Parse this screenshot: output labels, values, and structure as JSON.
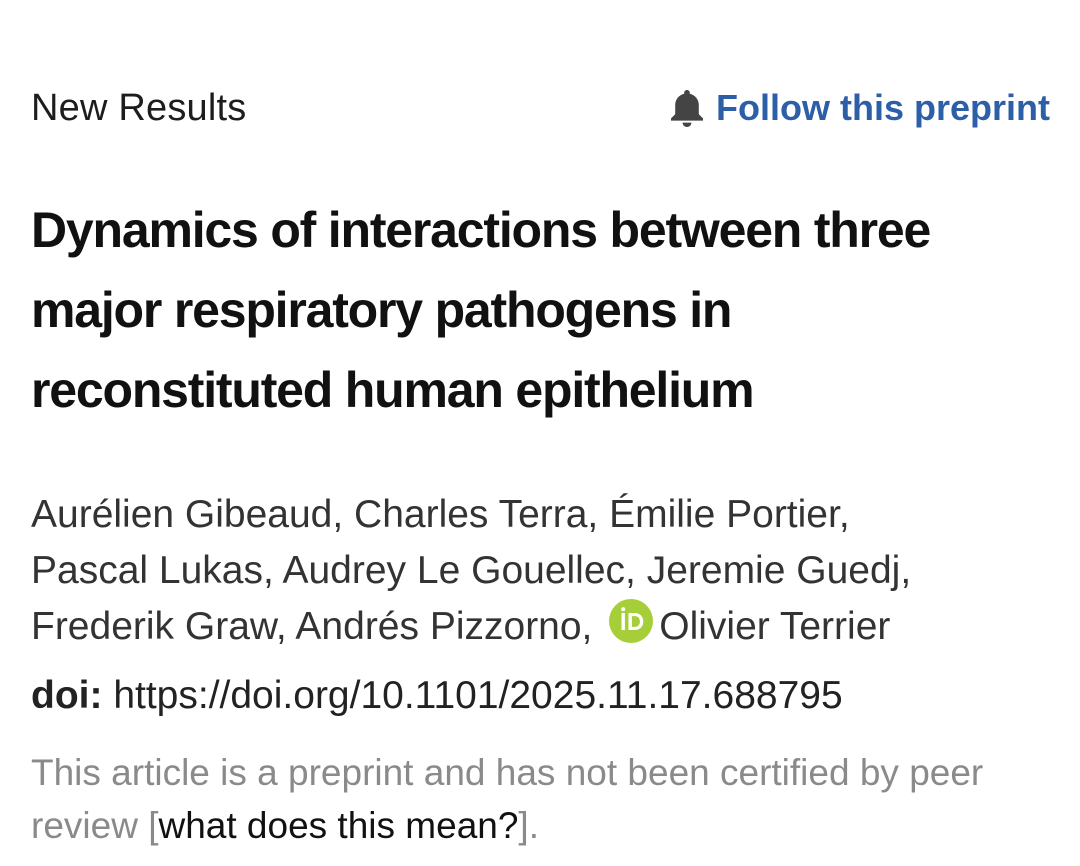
{
  "header": {
    "section_label": "New Results",
    "follow_label": "Follow this preprint",
    "follow_icon": "bell-icon",
    "accent_color": "#2d5fa8"
  },
  "article": {
    "title": "Dynamics of interactions between three major respiratory pathogens in reconstituted human epithelium",
    "authors": [
      "Aurélien Gibeaud, ",
      "Charles Terra, ",
      "Émilie Portier, ",
      "Pascal Lukas, ",
      "Audrey Le Gouellec, ",
      "Jeremie Guedj, ",
      "Frederik Graw, ",
      "Andrés Pizzorno, ",
      "Olivier Terrier"
    ],
    "orcid_icon": "orcid-icon",
    "orcid_color": "#a6ce39",
    "doi_label": "doi:",
    "doi_value": "https://doi.org/10.1101/2025.11.17.688795"
  },
  "review_note": {
    "text_before": "This article is a preprint and has not been certified by peer review [",
    "link_text": "what does this mean?",
    "text_after": "]."
  }
}
